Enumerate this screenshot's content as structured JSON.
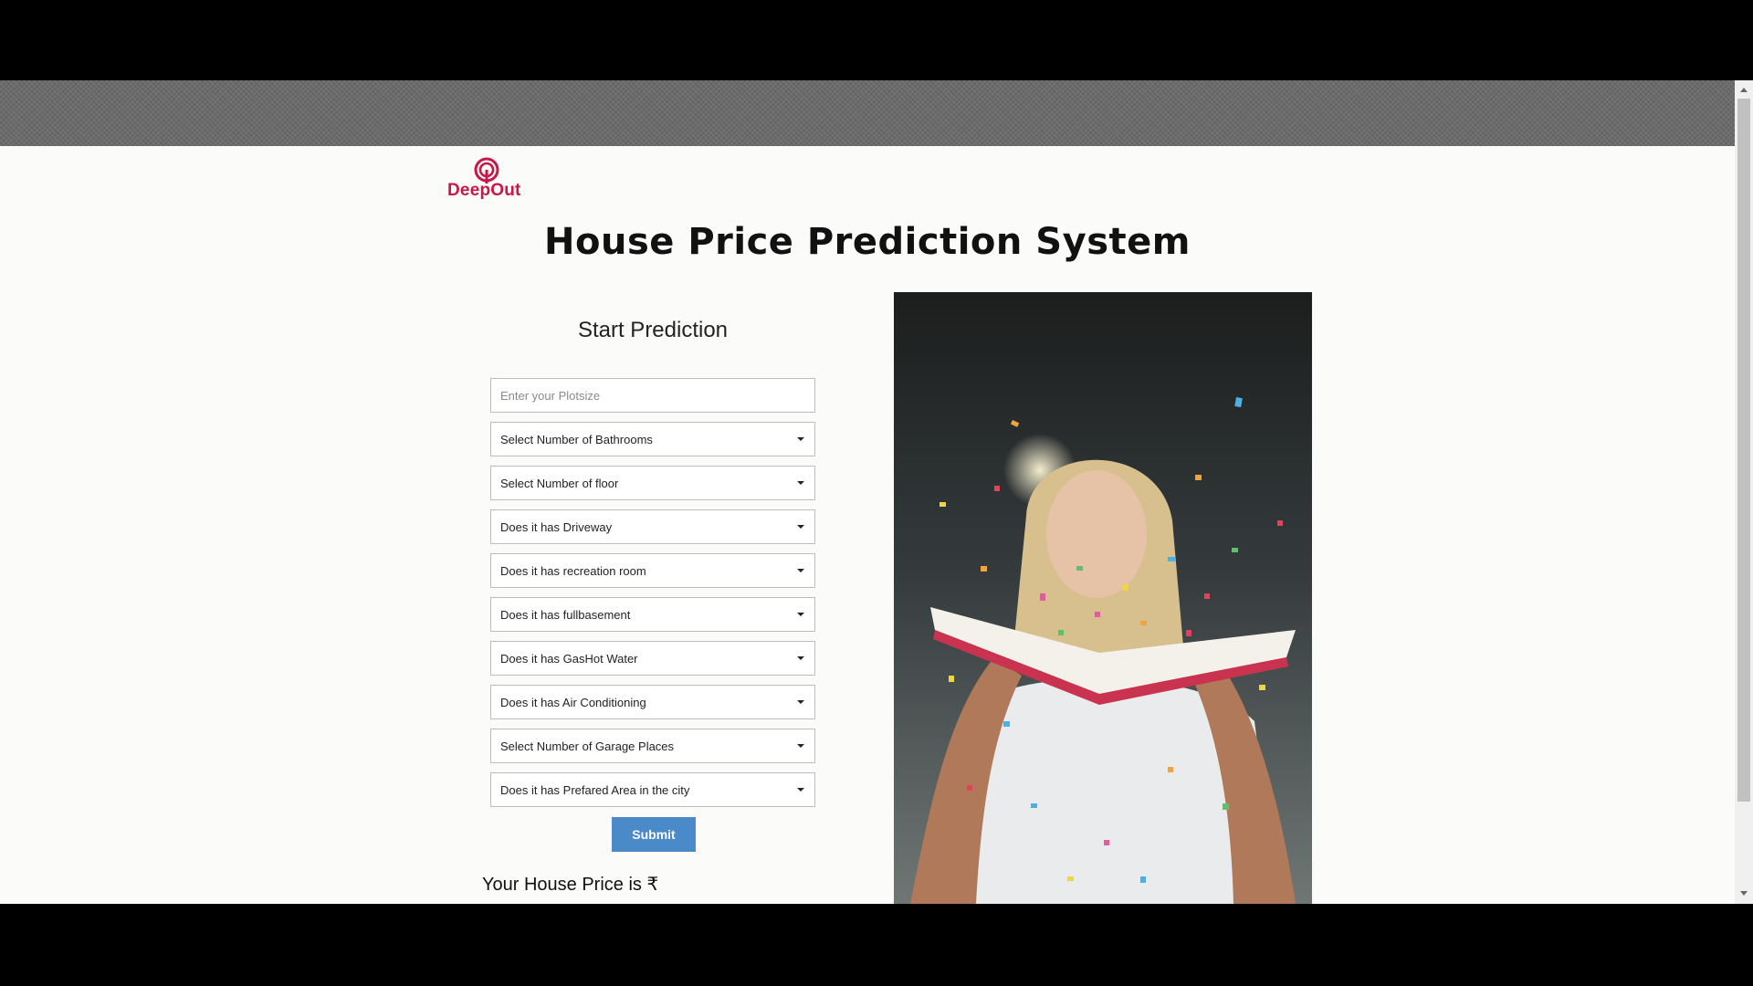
{
  "brand": {
    "name": "DeepOut",
    "color": "#c8174a"
  },
  "page": {
    "title": "House Price Prediction System"
  },
  "form": {
    "heading": "Start Prediction",
    "plotsize_placeholder": "Enter your Plotsize",
    "selects": [
      "Select Number of Bathrooms",
      "Select Number of floor",
      "Does it has Driveway",
      "Does it has recreation room",
      "Does it has fullbasement",
      "Does it has GasHot Water",
      "Does it has Air Conditioning",
      "Select Number of Garage Places",
      "Does it has Prefared Area in the city"
    ],
    "submit_label": "Submit",
    "submit_color": "#4a8ac9"
  },
  "result": {
    "label": "Your House Price is ₹"
  },
  "image": {
    "icon": "confetti-photo"
  }
}
